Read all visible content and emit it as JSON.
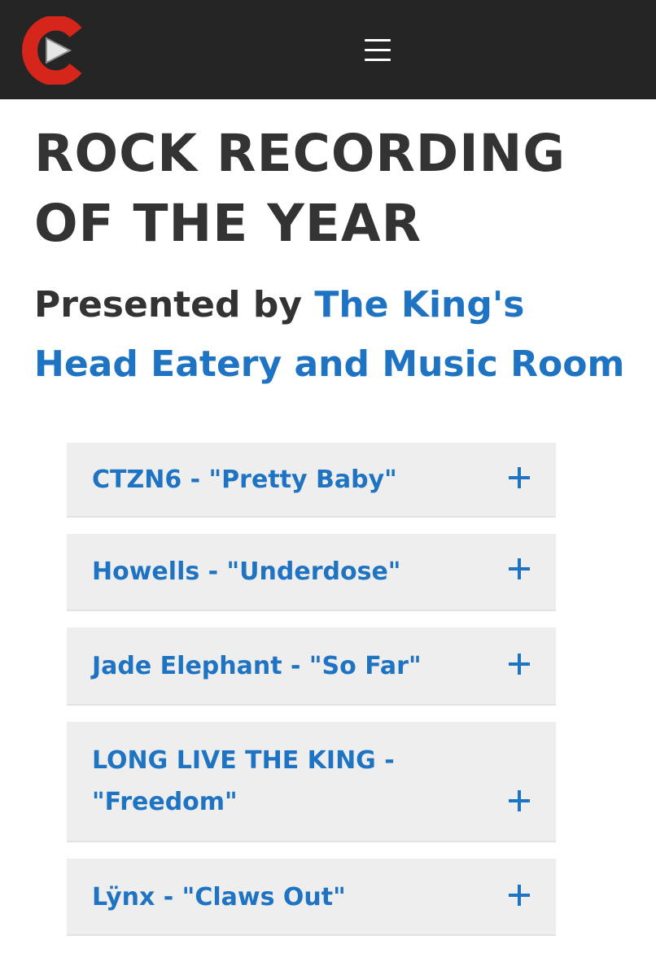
{
  "header": {
    "logo_icon": "play-button-c-logo",
    "menu_icon": "hamburger-menu-icon",
    "colors": {
      "background": "#252525",
      "logo_red": "#d6261c"
    }
  },
  "page": {
    "title": "ROCK RECORDING OF THE YEAR",
    "presented_prefix": "Presented by ",
    "presenter_link": "The King's Head Eatery and Music Room"
  },
  "colors": {
    "link": "#1f73c3",
    "text": "#333333",
    "panel": "#eeeeee"
  },
  "nominees": [
    {
      "label": "CTZN6 - \"Pretty Baby\"",
      "expanded": false
    },
    {
      "label": "Howells - \"Underdose\"",
      "expanded": false
    },
    {
      "label": "Jade Elephant - \"So Far\"",
      "expanded": false
    },
    {
      "label": "LONG LIVE THE KING - \"Freedom\"",
      "expanded": false
    },
    {
      "label": "Lÿnx - \"Claws Out\"",
      "expanded": false
    }
  ]
}
